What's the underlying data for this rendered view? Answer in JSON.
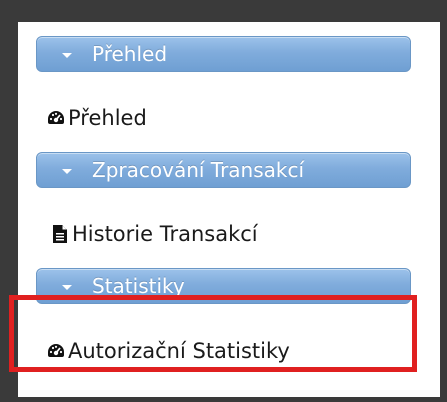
{
  "menu": {
    "sections": [
      {
        "label": "Přehled"
      },
      {
        "label": "Zpracování Transakcí"
      },
      {
        "label": "Statistiky"
      }
    ],
    "items": [
      {
        "label": "Přehled",
        "icon": "dashboard-icon"
      },
      {
        "label": "Historie Transakcí",
        "icon": "document-icon"
      },
      {
        "label": "Autorizační Statistiky",
        "icon": "dashboard-icon"
      }
    ]
  },
  "colors": {
    "header_top": "#9cc2ea",
    "header_bottom": "#6f9fd3",
    "highlight": "#e02020",
    "background": "#3a3a3a"
  }
}
